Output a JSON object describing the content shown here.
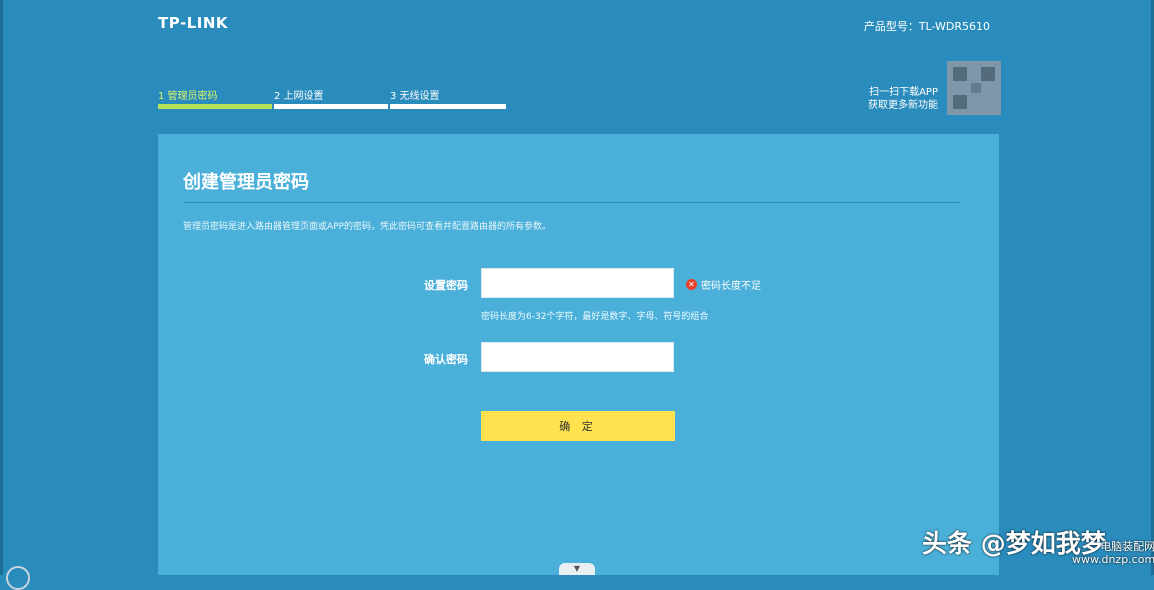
{
  "header": {
    "logo": "TP-LINK",
    "model": "产品型号：TL-WDR5610"
  },
  "steps": [
    {
      "label": "1 管理员密码",
      "active": true
    },
    {
      "label": "2 上网设置",
      "active": false
    },
    {
      "label": "3 无线设置",
      "active": false
    }
  ],
  "app_promo": {
    "line1": "扫一扫下载APP",
    "line2": "获取更多新功能"
  },
  "panel": {
    "title": "创建管理员密码",
    "description": "管理员密码是进入路由器管理页面或APP的密码，凭此密码可查看并配置路由器的所有参数。",
    "password_label": "设置密码",
    "password_value": "",
    "confirm_label": "确认密码",
    "confirm_value": "",
    "error_text": "密码长度不足",
    "hint": "密码长度为6-32个字符，最好是数字、字母、符号的组合",
    "submit_label": "确 定"
  },
  "watermark": {
    "text": "头条 @梦如我梦",
    "site_line1": "电脑装配网",
    "site_line2": "www.dnzp.com"
  },
  "colors": {
    "background": "#2a8cbc",
    "panel": "#4ab0d9",
    "active_step": "#b7e35b",
    "button": "#ffe24d",
    "error": "#e8412c"
  },
  "icons": {
    "error": "error-circle-icon",
    "scroll": "chevron-down-icon"
  }
}
